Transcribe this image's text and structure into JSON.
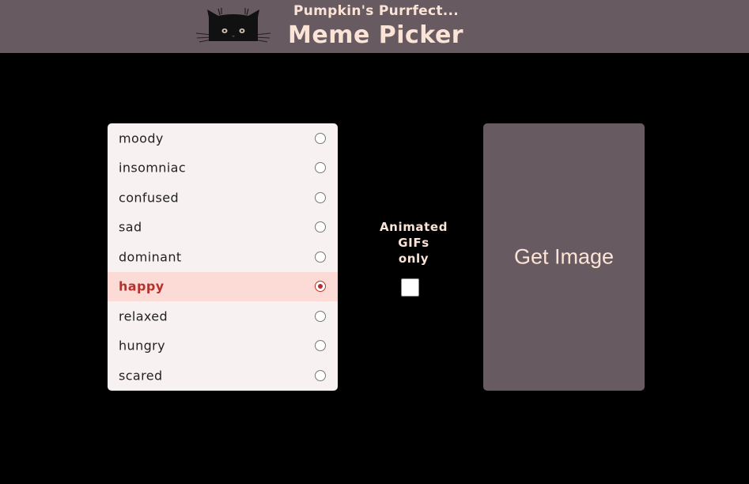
{
  "header": {
    "subtitle": "Pumpkin's Purrfect...",
    "title": "Meme Picker",
    "logo_icon": "black-cat-icon"
  },
  "moods": {
    "selected": "happy",
    "items": [
      {
        "label": "moody",
        "selected": false
      },
      {
        "label": "insomniac",
        "selected": false
      },
      {
        "label": "confused",
        "selected": false
      },
      {
        "label": "sad",
        "selected": false
      },
      {
        "label": "dominant",
        "selected": false
      },
      {
        "label": "happy",
        "selected": true
      },
      {
        "label": "relaxed",
        "selected": false
      },
      {
        "label": "hungry",
        "selected": false
      },
      {
        "label": "scared",
        "selected": false
      }
    ]
  },
  "gif_filter": {
    "label_lines": [
      "Animated",
      "GIFs",
      "only"
    ],
    "checked": false
  },
  "get_image_button": {
    "label": "Get Image"
  },
  "colors": {
    "header_bg": "#675a60",
    "page_bg": "#000000",
    "accent_text": "#fbe3d7",
    "selected_bg": "#fcdbd6",
    "selected_text": "#b3322d",
    "list_bg": "#f8f1f1"
  }
}
